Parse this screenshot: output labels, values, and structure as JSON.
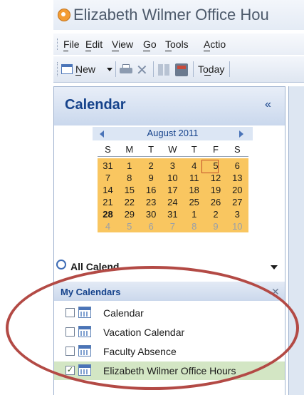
{
  "window": {
    "title": "Elizabeth Wilmer Office Hours",
    "title_visible": "Elizabeth Wilmer Office Hou"
  },
  "menu": {
    "items": [
      "File",
      "Edit",
      "View",
      "Go",
      "Tools",
      "Actions"
    ],
    "items_visible": [
      "File",
      "Edit",
      "View",
      "Go",
      "Tools",
      "Actio"
    ]
  },
  "toolbar": {
    "new_label": "New",
    "today_label": "Today"
  },
  "nav_pane": {
    "title": "Calendar",
    "collapse_glyph": "«"
  },
  "date_navigator": {
    "month": "August 2011",
    "weekdays": [
      "S",
      "M",
      "T",
      "W",
      "T",
      "F",
      "S"
    ],
    "weeks": [
      [
        "31",
        "1",
        "2",
        "3",
        "4",
        "5",
        "6"
      ],
      [
        "7",
        "8",
        "9",
        "10",
        "11",
        "12",
        "13"
      ],
      [
        "14",
        "15",
        "16",
        "17",
        "18",
        "19",
        "20"
      ],
      [
        "21",
        "22",
        "23",
        "24",
        "25",
        "26",
        "27"
      ],
      [
        "28",
        "29",
        "30",
        "31",
        "1",
        "2",
        "3"
      ],
      [
        "4",
        "5",
        "6",
        "7",
        "8",
        "9",
        "10"
      ]
    ],
    "today": "5",
    "highlight_color": "#f9c660"
  },
  "all_items": {
    "label": "All Calendar Items",
    "label_visible": "All Calend"
  },
  "my_calendars": {
    "title": "My Calendars",
    "items": [
      {
        "label": "Calendar",
        "checked": false
      },
      {
        "label": "Vacation Calendar",
        "checked": false
      },
      {
        "label": "Faculty Absence",
        "checked": false
      },
      {
        "label": "Elizabeth Wilmer Office Hours",
        "checked": true
      }
    ]
  },
  "annotation": {
    "ellipse_color": "#b34a45"
  },
  "icons": [
    "outlook-calendar-icon",
    "new-calendar-icon",
    "print-icon",
    "delete-icon",
    "grid-view-icon",
    "address-book-icon",
    "search-folder-icon",
    "calendar-icon"
  ]
}
